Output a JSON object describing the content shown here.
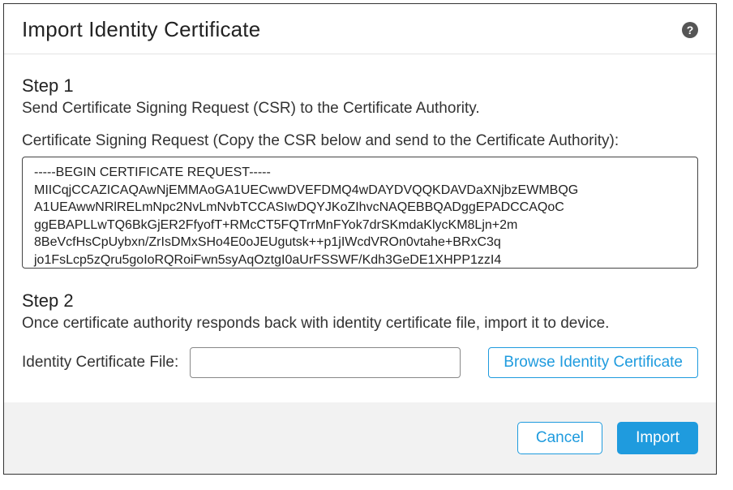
{
  "header": {
    "title": "Import Identity Certificate",
    "help": "?"
  },
  "step1": {
    "heading": "Step 1",
    "text": "Send Certificate Signing Request (CSR) to the Certificate Authority.",
    "csr_label": "Certificate Signing Request (Copy the CSR below and send to the Certificate Authority):",
    "csr_value": "-----BEGIN CERTIFICATE REQUEST-----\nMIICqjCCAZICAQAwNjEMMAoGA1UECwwDVEFDMQ4wDAYDVQQKDAVDaXNjbzEWMBQG\nA1UEAwwNRlRELmNpc2NvLmNvbTCCASIwDQYJKoZIhvcNAQEBBQADggEPADCCAQoC\nggEBAPLLwTQ6BkGjER2FfyofT+RMcCT5FQTrrMnFYok7drSKmdaKlycKM8Ljn+2m\n8BeVcfHsCpUybxn/ZrIsDMxSHo4E0oJEUgutsk++p1jIWcdVROn0vtahe+BRxC3q\njo1FsLcp5zQru5goIoRQRoiFwn5syAqOztgI0aUrFSSWF/Kdh3GeDE1XHPP1zzI4"
  },
  "step2": {
    "heading": "Step 2",
    "text": "Once certificate authority responds back with identity certificate file, import it to device.",
    "file_label": "Identity Certificate File:",
    "file_value": "",
    "browse_label": "Browse Identity Certificate"
  },
  "footer": {
    "cancel_label": "Cancel",
    "import_label": "Import"
  }
}
